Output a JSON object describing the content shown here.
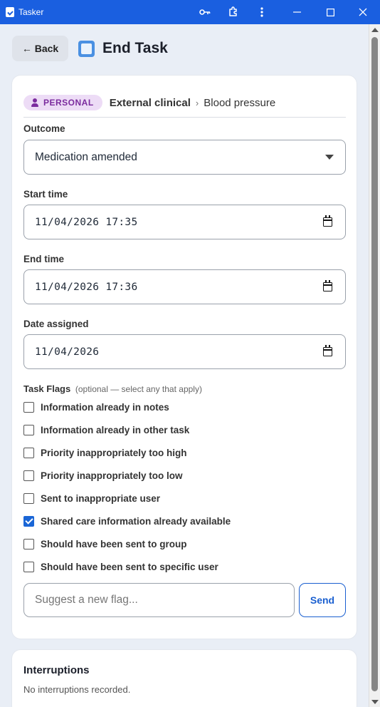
{
  "window": {
    "title": "Tasker",
    "icons": [
      "key-icon",
      "extension-icon",
      "more-vert-icon",
      "minimize-icon",
      "maximize-icon",
      "close-icon"
    ]
  },
  "header": {
    "back_label": "← Back",
    "title": "End Task"
  },
  "task": {
    "badge": "PERSONAL",
    "breadcrumb_1": "External clinical",
    "breadcrumb_sep": "›",
    "breadcrumb_2": "Blood pressure"
  },
  "form": {
    "outcome_label": "Outcome",
    "outcome_value": "Medication amended",
    "start_label": "Start time",
    "start_value": "11/04/2026 17:35",
    "end_label": "End time",
    "end_value": "11/04/2026 17:36",
    "assigned_label": "Date assigned",
    "assigned_value": "11/04/2026"
  },
  "flags": {
    "label": "Task Flags",
    "optional_text": "(optional — select any that apply)",
    "items": [
      {
        "label": "Information already in notes",
        "checked": false
      },
      {
        "label": "Information already in other task",
        "checked": false
      },
      {
        "label": "Priority inappropriately too high",
        "checked": false
      },
      {
        "label": "Priority inappropriately too low",
        "checked": false
      },
      {
        "label": "Sent to inappropriate user",
        "checked": false
      },
      {
        "label": "Shared care information already available",
        "checked": true
      },
      {
        "label": "Should have been sent to group",
        "checked": false
      },
      {
        "label": "Should have been sent to specific user",
        "checked": false
      }
    ],
    "suggest_placeholder": "Suggest a new flag...",
    "send_label": "Send"
  },
  "interruptions": {
    "title": "Interruptions",
    "empty_text": "No interruptions recorded."
  },
  "colors": {
    "titlebar": "#1a5fe0",
    "accent": "#1a66d6",
    "badge_bg": "#eddcf6",
    "badge_text": "#7b2b9e",
    "page_bg": "#e9eef6"
  }
}
